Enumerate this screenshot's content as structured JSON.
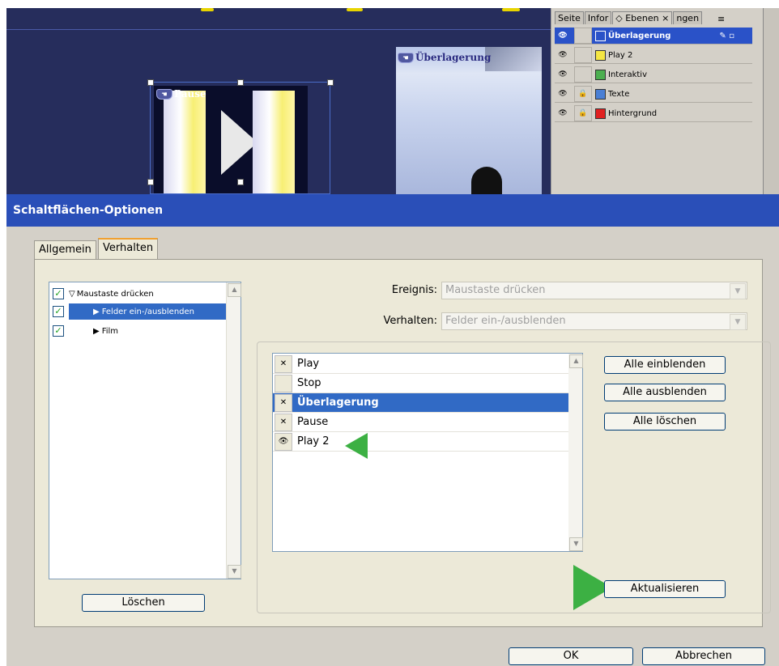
{
  "layers_panel": {
    "tabs": [
      "Seite",
      "Infor",
      "Ebenen",
      "ngen"
    ],
    "layers": [
      {
        "name": "Überlagerung",
        "color": "#2a52c8",
        "locked": false,
        "selected": true
      },
      {
        "name": "Play 2",
        "color": "#f5e642",
        "locked": false,
        "selected": false
      },
      {
        "name": "Interaktiv",
        "color": "#4caf50",
        "locked": false,
        "selected": false
      },
      {
        "name": "Texte",
        "color": "#4a7fd4",
        "locked": true,
        "selected": false
      },
      {
        "name": "Hintergrund",
        "color": "#e02020",
        "locked": true,
        "selected": false
      }
    ]
  },
  "canvas": {
    "pause_label": "Pause",
    "overlay_label": "Überlagerung"
  },
  "dialog": {
    "title": "Schaltflächen-Optionen",
    "tabs": {
      "allgemein": "Allgemein",
      "verhalten": "Verhalten"
    },
    "actions": [
      {
        "label": "Maustaste drücken",
        "checked": true,
        "type": "event"
      },
      {
        "label": "Felder ein-/ausblenden",
        "checked": true,
        "type": "action",
        "selected": true
      },
      {
        "label": "Film",
        "checked": true,
        "type": "action"
      }
    ],
    "delete_button": "Löschen",
    "event_label": "Ereignis:",
    "event_value": "Maustaste drücken",
    "behavior_label": "Verhalten:",
    "behavior_value": "Felder ein-/ausblenden",
    "fields": [
      {
        "label": "Play",
        "state": "hide"
      },
      {
        "label": "Stop",
        "state": "none"
      },
      {
        "label": "Überlagerung",
        "state": "hide",
        "selected": true
      },
      {
        "label": "Pause",
        "state": "hide"
      },
      {
        "label": "Play 2",
        "state": "show"
      }
    ],
    "show_all_button": "Alle einblenden",
    "hide_all_button": "Alle ausblenden",
    "clear_all_button": "Alle löschen",
    "update_button": "Aktualisieren",
    "ok_button": "OK",
    "cancel_button": "Abbrechen",
    "accent_color": "#2a4fb8",
    "annotation_color": "#3cb043"
  }
}
